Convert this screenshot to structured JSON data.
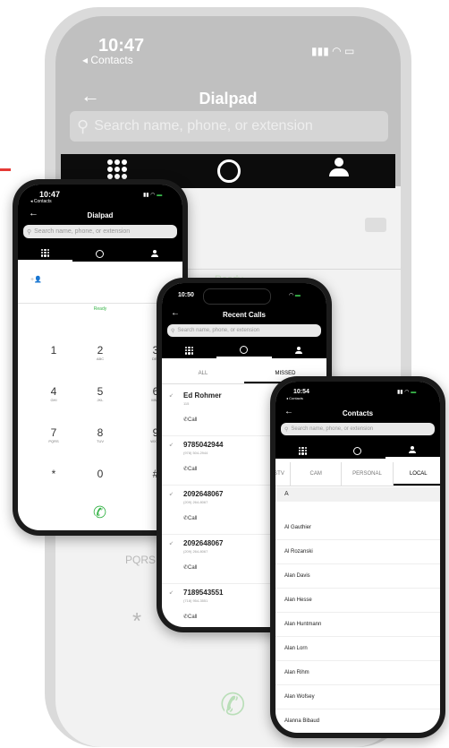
{
  "big_phone": {
    "time": "10:47",
    "back_label": "◂ Contacts",
    "title": "Dialpad",
    "search_placeholder": "Search name, phone, or extension",
    "status": "Ready",
    "keys": [
      {
        "digit": "7",
        "letters": "PQRS"
      },
      {
        "digit": "*",
        "letters": ""
      }
    ]
  },
  "dialpad_phone": {
    "time": "10:47",
    "back_label": "◂ Contacts",
    "title": "Dialpad",
    "search_placeholder": "Search name, phone, or extension",
    "status": "Ready",
    "keys": [
      {
        "digit": "1",
        "letters": ""
      },
      {
        "digit": "2",
        "letters": "ABC"
      },
      {
        "digit": "3",
        "letters": "DEF"
      },
      {
        "digit": "4",
        "letters": "GHI"
      },
      {
        "digit": "5",
        "letters": "JKL"
      },
      {
        "digit": "6",
        "letters": "MNO"
      },
      {
        "digit": "7",
        "letters": "PQRS"
      },
      {
        "digit": "8",
        "letters": "TUV"
      },
      {
        "digit": "9",
        "letters": "WXYZ"
      },
      {
        "digit": "*",
        "letters": ""
      },
      {
        "digit": "0",
        "letters": "+"
      },
      {
        "digit": "#",
        "letters": ""
      }
    ]
  },
  "recent_phone": {
    "time": "10:50",
    "title": "Recent Calls",
    "search_placeholder": "Search name, phone, or extension",
    "filter_all": "ALL",
    "filter_missed": "MISSED",
    "call_label": "Call",
    "calls": [
      {
        "name": "Ed Rohmer",
        "sub": "115"
      },
      {
        "name": "9785042944",
        "sub": "(978) 504-2944"
      },
      {
        "name": "2092648067",
        "sub": "(209) 264-8067"
      },
      {
        "name": "2092648067",
        "sub": "(209) 264-8067"
      },
      {
        "name": "7189543551",
        "sub": "(718) 954-3551"
      }
    ]
  },
  "contacts_phone": {
    "time": "10:54",
    "back_label": "◂ Contacts",
    "title": "Contacts",
    "search_placeholder": "Search name, phone, or extension",
    "tabs": [
      "STV",
      "CAM",
      "PERSONAL",
      "LOCAL"
    ],
    "section": "A",
    "contacts": [
      "Al Gauthier",
      "Al Rozanski",
      "Alan Davis",
      "Alan Hesse",
      "Alan Huntmann",
      "Alan Lorn",
      "Alan Rihm",
      "Alan Wofsey",
      "Alanna Bibaud"
    ]
  },
  "colors": {
    "accent_green": "#38b449",
    "nav_black": "#000000"
  }
}
